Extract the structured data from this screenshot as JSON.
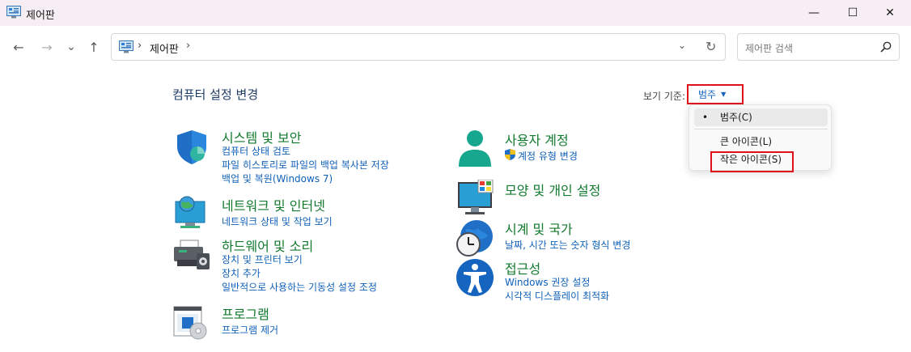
{
  "window": {
    "title": "제어판",
    "minimize_glyph": "—",
    "maximize_glyph": "☐",
    "close_glyph": "✕"
  },
  "nav": {
    "back_glyph": "←",
    "forward_glyph": "→",
    "recent_glyph": "⌄",
    "up_glyph": "↑"
  },
  "address": {
    "chevron": "›",
    "crumb": "제어판",
    "dropdown_glyph": "⌄",
    "refresh_glyph": "↻"
  },
  "search": {
    "placeholder": "제어판 검색"
  },
  "main": {
    "title": "컴퓨터 설정 변경",
    "view_by_label": "보기 기준:",
    "view_by_value": "범주",
    "view_by_arrow": "▼"
  },
  "categories": [
    {
      "heading": "시스템 및 보안",
      "links": [
        "컴퓨터 상태 검토",
        "파일 히스토리로 파일의 백업 복사본 저장",
        "백업 및 복원(Windows 7)"
      ],
      "icon": "shield-icon"
    },
    {
      "heading": "네트워크 및 인터넷",
      "links": [
        "네트워크 상태 및 작업 보기"
      ],
      "icon": "network-globe-icon"
    },
    {
      "heading": "하드웨어 및 소리",
      "links": [
        "장치 및 프린터 보기",
        "장치 추가",
        "일반적으로 사용하는 기동성 설정 조정"
      ],
      "icon": "printer-icon"
    },
    {
      "heading": "프로그램",
      "links": [
        "프로그램 제거"
      ],
      "icon": "program-disc-icon"
    },
    {
      "heading": "사용자 계정",
      "links": [
        "계정 유형 변경"
      ],
      "icon": "user-icon"
    },
    {
      "heading": "모양 및 개인 설정",
      "links": [],
      "icon": "monitor-icon"
    },
    {
      "heading": "시계 및 국가",
      "links": [
        "날짜, 시간 또는 숫자 형식 변경"
      ],
      "icon": "clock-globe-icon"
    },
    {
      "heading": "접근성",
      "links": [
        "Windows 권장 설정",
        "시각적 디스플레이 최적화"
      ],
      "icon": "accessibility-icon"
    }
  ],
  "view_menu": {
    "bullet": "•",
    "items": [
      "범주(C)",
      "큰 아이콘(L)",
      "작은 아이콘(S)"
    ],
    "selected_index": 0
  },
  "colors": {
    "heading_green": "#127a2e",
    "link_blue": "#1060b8",
    "highlight_red": "#e0101a"
  }
}
